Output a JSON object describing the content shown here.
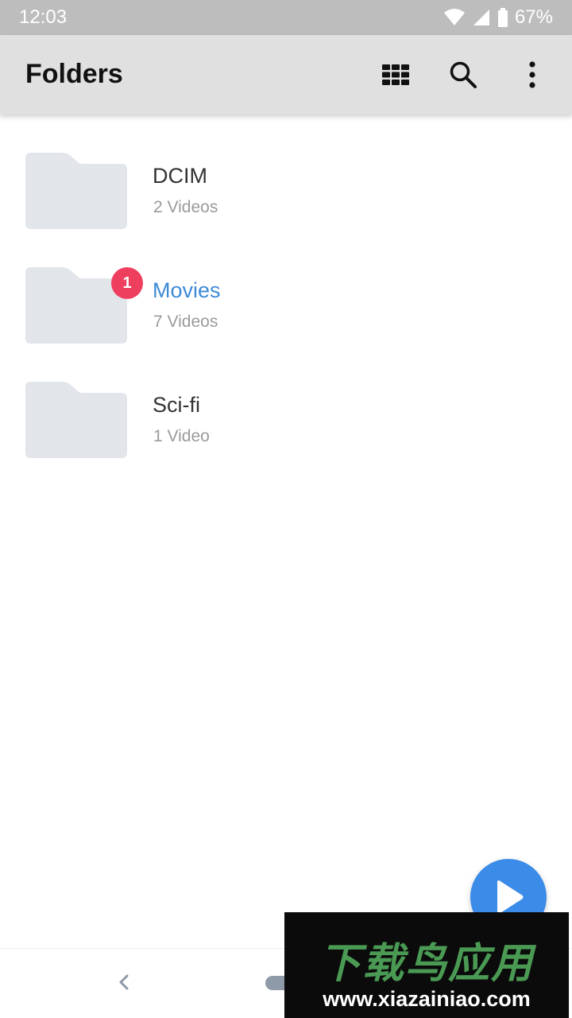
{
  "status_bar": {
    "time": "12:03",
    "battery_text": "67%",
    "icons": [
      "wifi-icon",
      "signal-icon",
      "battery-icon"
    ]
  },
  "app_bar": {
    "title": "Folders",
    "actions": [
      "grid-view-icon",
      "search-icon",
      "more-vert-icon"
    ]
  },
  "folders": [
    {
      "name": "DCIM",
      "count": "2 Videos",
      "badge": "",
      "active": false
    },
    {
      "name": "Movies",
      "count": "7 Videos",
      "badge": "1",
      "active": true
    },
    {
      "name": "Sci-fi",
      "count": "1 Video",
      "badge": "",
      "active": false
    }
  ],
  "fab": {
    "icon": "play-icon"
  },
  "nav_bar": {
    "icons": [
      "back-icon",
      "home-pill"
    ]
  },
  "watermark": {
    "title": "下载鸟应用",
    "url": "www.xiazainiao.com"
  },
  "colors": {
    "accent": "#3b8be8",
    "active_folder": "#3d8ad6",
    "badge": "#ef3f5e",
    "folder_icon": "#e2e5ea",
    "app_bar": "#e0e0e0",
    "status_bar": "#bdbdbd"
  }
}
